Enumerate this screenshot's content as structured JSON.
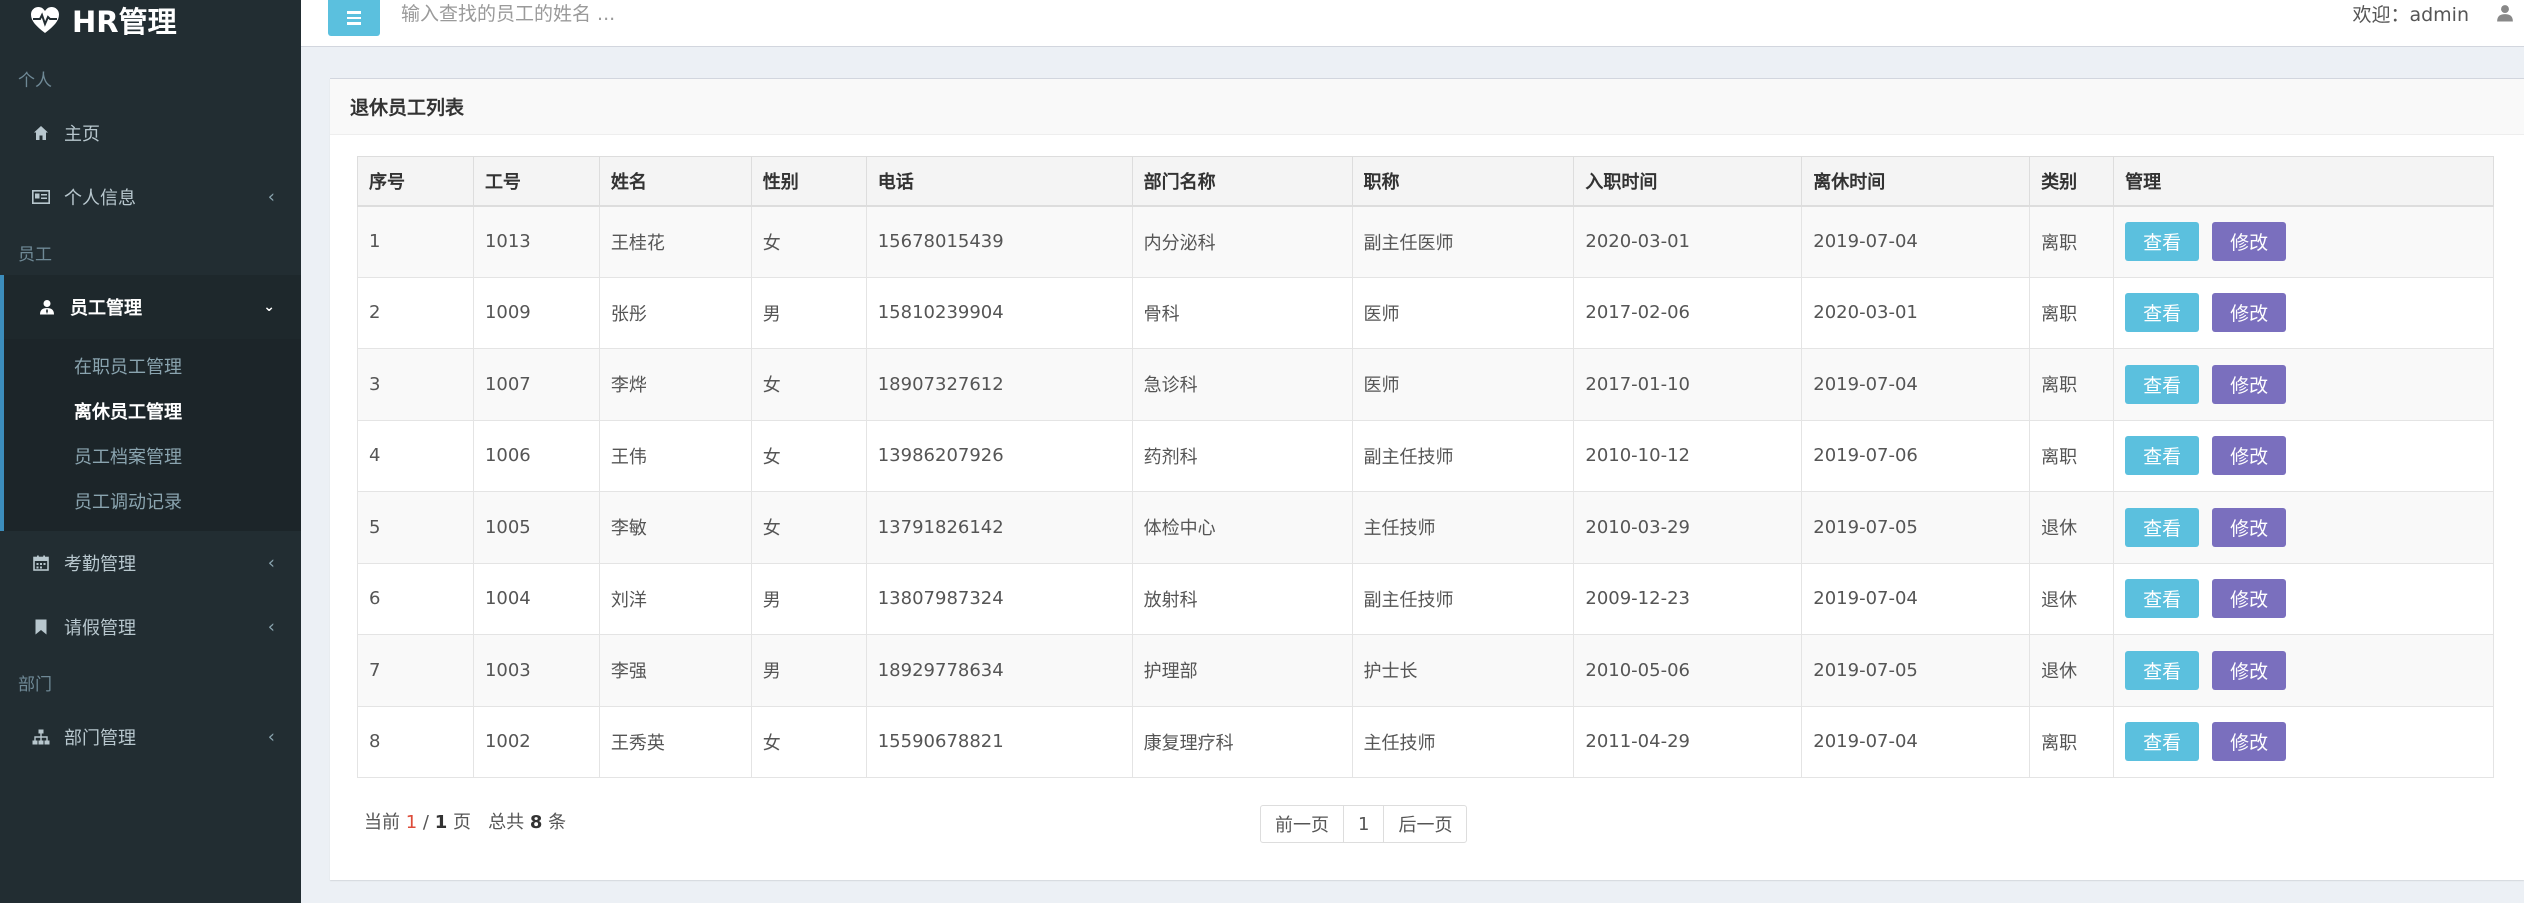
{
  "app": {
    "title": "HR管理"
  },
  "sidebar": {
    "section_personal": "个人",
    "home": "主页",
    "personal_info": "个人信息",
    "section_staff": "员工",
    "staff_mgmt": "员工管理",
    "staff_sub": [
      "在职员工管理",
      "离休员工管理",
      "员工档案管理",
      "员工调动记录"
    ],
    "attendance": "考勤管理",
    "leave": "请假管理",
    "section_dept": "部门",
    "dept_mgmt": "部门管理"
  },
  "topbar": {
    "search_placeholder": "输入查找的员工的姓名 ...",
    "welcome": "欢迎：admin"
  },
  "box": {
    "title": "退休员工列表"
  },
  "table": {
    "headers": [
      "序号",
      "工号",
      "姓名",
      "性别",
      "电话",
      "部门名称",
      "职称",
      "入职时间",
      "离休时间",
      "类别",
      "管理"
    ],
    "view_label": "查看",
    "edit_label": "修改",
    "rows": [
      [
        "1",
        "1013",
        "王桂花",
        "女",
        "15678015439",
        "内分泌科",
        "副主任医师",
        "2020-03-01",
        "2019-07-04",
        "离职"
      ],
      [
        "2",
        "1009",
        "张彤",
        "男",
        "15810239904",
        "骨科",
        "医师",
        "2017-02-06",
        "2020-03-01",
        "离职"
      ],
      [
        "3",
        "1007",
        "李烨",
        "女",
        "18907327612",
        "急诊科",
        "医师",
        "2017-01-10",
        "2019-07-04",
        "离职"
      ],
      [
        "4",
        "1006",
        "王伟",
        "女",
        "13986207926",
        "药剂科",
        "副主任技师",
        "2010-10-12",
        "2019-07-06",
        "离职"
      ],
      [
        "5",
        "1005",
        "李敏",
        "女",
        "13791826142",
        "体检中心",
        "主任技师",
        "2010-03-29",
        "2019-07-05",
        "退休"
      ],
      [
        "6",
        "1004",
        "刘洋",
        "男",
        "13807987324",
        "放射科",
        "副主任技师",
        "2009-12-23",
        "2019-07-04",
        "退休"
      ],
      [
        "7",
        "1003",
        "李强",
        "男",
        "18929778634",
        "护理部",
        "护士长",
        "2010-05-06",
        "2019-07-05",
        "退休"
      ],
      [
        "8",
        "1002",
        "王秀英",
        "女",
        "15590678821",
        "康复理疗科",
        "主任技师",
        "2011-04-29",
        "2019-07-04",
        "离职"
      ]
    ]
  },
  "pager": {
    "prefix": "当前",
    "current": "1",
    "sep": "/",
    "total_pages": "1",
    "page_word": "页",
    "total_prefix": "总共",
    "total_count": "8",
    "count_word": "条",
    "prev": "前一页",
    "page": "1",
    "next": "后一页"
  },
  "colors": {
    "sidebar_bg": "#222d32",
    "accent": "#3c8dbc",
    "view_btn": "#5bc0de",
    "edit_btn": "#7a6fbe",
    "highlight": "#dd4b39"
  }
}
